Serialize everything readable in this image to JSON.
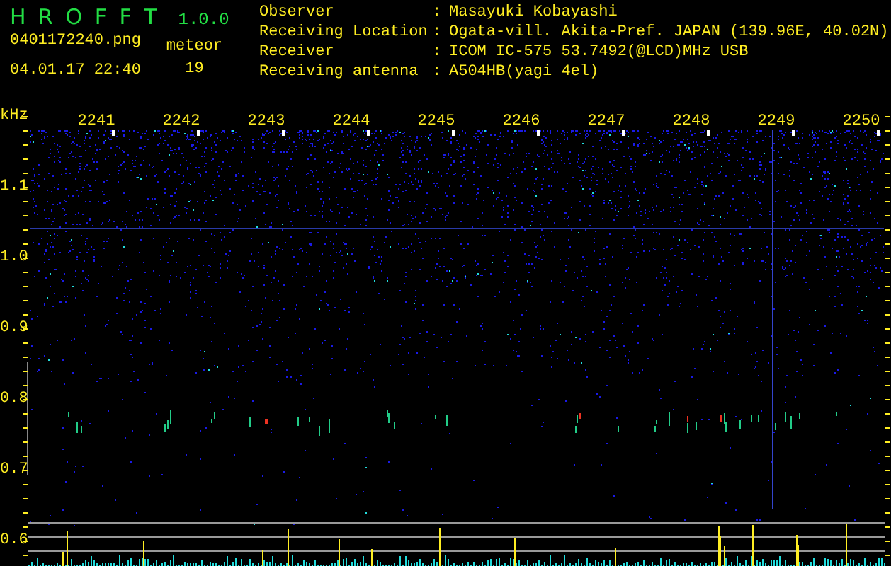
{
  "app": {
    "name": "H R O F F T",
    "version": "1.0.0"
  },
  "file": {
    "name": "0401172240.png",
    "timestamp": "04.01.17 22:40"
  },
  "meteor": {
    "label": "meteor",
    "count": "19"
  },
  "station": [
    {
      "label": "Observer",
      "separator": ":",
      "value": "Masayuki Kobayashi"
    },
    {
      "label": "Receiving Location",
      "separator": ":",
      "value": "Ogata-vill. Akita-Pref. JAPAN (139.96E, 40.02N)"
    },
    {
      "label": "Receiver",
      "separator": ":",
      "value": "ICOM IC-575 53.7492(@LCD)MHz USB"
    },
    {
      "label": "Receiving antenna",
      "separator": ":",
      "value": "A504HB(yagi 4el)"
    }
  ],
  "spectrogram": {
    "unit": "kHz",
    "time_labels": [
      "2241",
      "2242",
      "2243",
      "2244",
      "2245",
      "2246",
      "2247",
      "2248",
      "2249",
      "2250"
    ],
    "frequency_labels": [
      "1.1",
      "1.0",
      "0.9",
      "0.8",
      "0.7",
      "0.6"
    ]
  }
}
